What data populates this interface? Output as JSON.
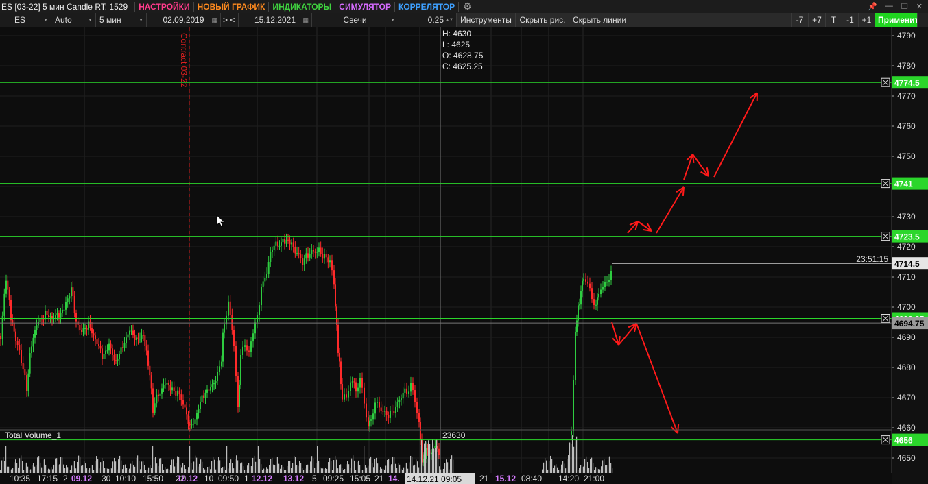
{
  "window": {
    "title": "ES [03-22] 5 мин Candle RT: 1529",
    "menus": [
      {
        "label": "НАСТРОЙКИ",
        "color": "#ff3b8b"
      },
      {
        "label": "НОВЫЙ ГРАФИК",
        "color": "#ff8a1e"
      },
      {
        "label": "ИНДИКАТОРЫ",
        "color": "#3fd13f"
      },
      {
        "label": "СИМУЛЯТОР",
        "color": "#d66bff"
      },
      {
        "label": "КОРРЕЛЯТОР",
        "color": "#3ea0ff"
      }
    ]
  },
  "toolbar": {
    "symbol": "ES",
    "scale": "Auto",
    "timeframe": "5 мин",
    "date_from": "02.09.2019",
    "nav": "> <",
    "date_to": "15.12.2021",
    "chart_type": "Свечи",
    "tick_size": "0.25",
    "instruments": "Инструменты",
    "hide_drawings": "Скрыть рис.",
    "hide_lines": "Скрыть линии",
    "btn_minus7": "-7",
    "btn_plus7": "+7",
    "btn_t": "T",
    "btn_minus1": "-1",
    "btn_plus1": "+1",
    "apply": "Применить"
  },
  "ohlc": {
    "h": "H: 4630",
    "l": "L: 4625",
    "o": "O: 4628.75",
    "c": "C: 4625.25"
  },
  "contract_label": "Contract 03-22",
  "volume_label": "Total Volume_1",
  "volume_value": "23630",
  "timer": "23:51:15",
  "price_axis": [
    "4790",
    "4780",
    "4770",
    "4760",
    "4750",
    "4740",
    "4730",
    "4720",
    "4710",
    "4700",
    "4690",
    "4680",
    "4670",
    "4660",
    "4650"
  ],
  "levels": [
    {
      "price": 4774.5,
      "label": "4774.5"
    },
    {
      "price": 4741,
      "label": "4741"
    },
    {
      "price": 4723.5,
      "label": "4723.5"
    },
    {
      "price": 4696.25,
      "label": "4696.25"
    },
    {
      "price": 4656,
      "label": "4656"
    }
  ],
  "current_price": {
    "price": 4714.5,
    "label": "4714.5"
  },
  "crosshair_price": {
    "price": 4694.75,
    "label": "4694.75"
  },
  "time_axis": [
    {
      "label": "10:35",
      "hl": false
    },
    {
      "label": "17:15",
      "hl": false
    },
    {
      "label": "2",
      "hl": false
    },
    {
      "label": "09.12",
      "hl": true
    },
    {
      "label": "30",
      "hl": false
    },
    {
      "label": "10:10",
      "hl": false
    },
    {
      "label": "15:50",
      "hl": false
    },
    {
      "label": "22",
      "hl": false
    },
    {
      "label": "10.12",
      "hl": true
    },
    {
      "label": "10",
      "hl": false
    },
    {
      "label": "09:50",
      "hl": false
    },
    {
      "label": "1",
      "hl": false
    },
    {
      "label": "12.12",
      "hl": true
    },
    {
      "label": "13.12",
      "hl": true
    },
    {
      "label": "5",
      "hl": false
    },
    {
      "label": "09:25",
      "hl": false
    },
    {
      "label": "15:05",
      "hl": false
    },
    {
      "label": "21",
      "hl": false
    },
    {
      "label": "14.",
      "hl": true
    },
    {
      "label": "14.12.21 09:05",
      "hl": false
    },
    {
      "label": "21",
      "hl": false
    },
    {
      "label": "15.12",
      "hl": true
    },
    {
      "label": "08:40",
      "hl": false
    },
    {
      "label": "14:20",
      "hl": false
    },
    {
      "label": "21:00",
      "hl": false
    }
  ],
  "colors": {
    "up": "#2ecc40",
    "down": "#ff2a2a",
    "level": "#2bd62b",
    "arrow": "#ff1a1a",
    "date_highlight": "#d57cff"
  }
}
